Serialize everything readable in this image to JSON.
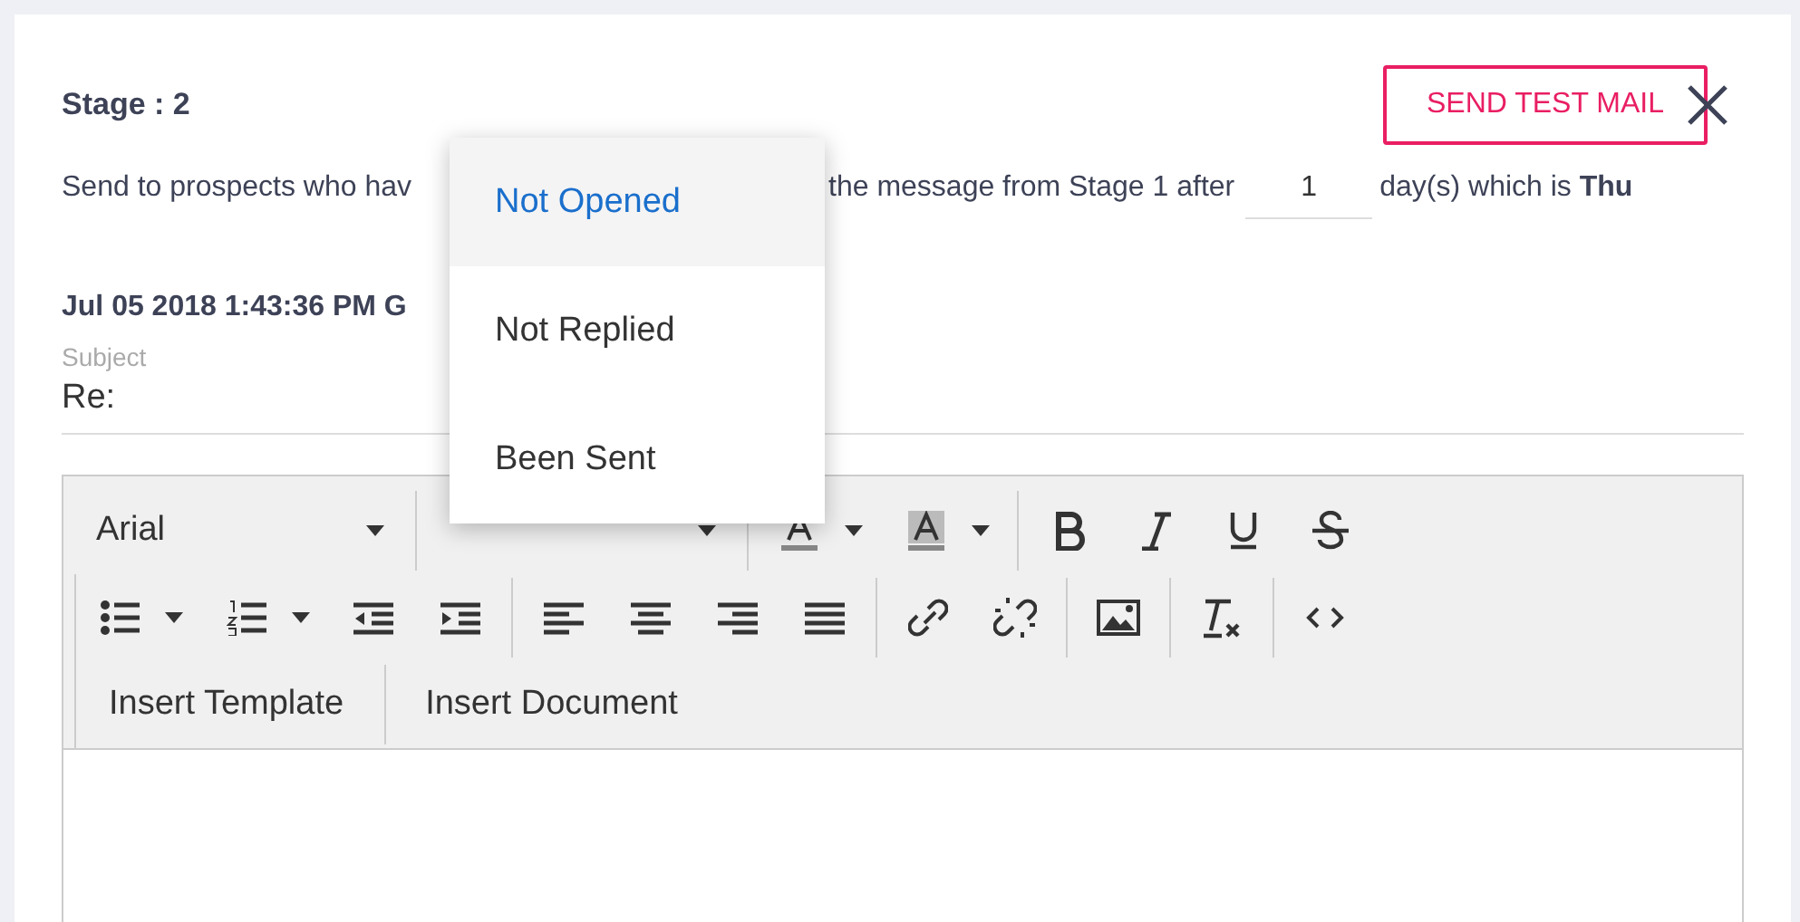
{
  "stage": {
    "title": "Stage : 2"
  },
  "test_button": {
    "label": "SEND TEST MAIL"
  },
  "rule": {
    "before": "Send to prospects who hav",
    "after": "the message from Stage 1 after",
    "days": "1",
    "suffix": "day(s) which is **Thu**"
  },
  "dropdown": {
    "options": [
      {
        "label": "Not Opened",
        "selected": true
      },
      {
        "label": "Not Replied",
        "selected": false
      },
      {
        "label": "Been Sent",
        "selected": false
      }
    ]
  },
  "date": "Jul 05 2018 1:43:36 PM G",
  "subject": {
    "label": "Subject",
    "value": "Re:"
  },
  "toolbar": {
    "font": "Arial",
    "buttons": [
      "Insert Template",
      "Insert Document"
    ]
  }
}
